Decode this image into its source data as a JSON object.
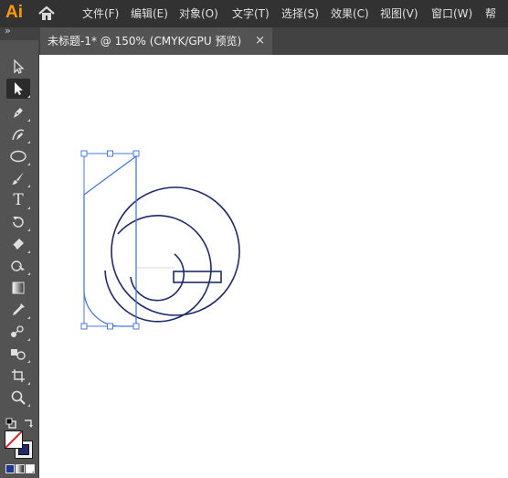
{
  "app": {
    "logo_text": "Ai",
    "home_icon": "home-icon"
  },
  "menu": [
    {
      "label": "文件(F)"
    },
    {
      "label": "编辑(E)"
    },
    {
      "label": "对象(O)"
    },
    {
      "label": "文字(T)"
    },
    {
      "label": "选择(S)"
    },
    {
      "label": "效果(C)"
    },
    {
      "label": "视图(V)"
    },
    {
      "label": "窗口(W)"
    },
    {
      "label": "帮"
    }
  ],
  "document_tab": {
    "label": "未标题-1* @ 150% (CMYK/GPU 预览)",
    "close_label": "×"
  },
  "toolbar": {
    "collapse_label": "»",
    "tools": [
      {
        "icon": "selection-tool-icon"
      },
      {
        "icon": "direct-selection-tool-icon",
        "active": true
      },
      {
        "icon": "pen-tool-icon"
      },
      {
        "icon": "curvature-tool-icon"
      },
      {
        "icon": "ellipse-tool-icon"
      },
      {
        "icon": "paintbrush-tool-icon"
      },
      {
        "icon": "type-tool-icon",
        "text": "T"
      },
      {
        "icon": "rotate-tool-icon"
      },
      {
        "icon": "eraser-tool-icon"
      },
      {
        "icon": "warp-tool-icon"
      },
      {
        "icon": "gradient-tool-icon"
      },
      {
        "icon": "eyedropper-tool-icon"
      },
      {
        "icon": "blend-tool-icon"
      },
      {
        "icon": "shape-builder-tool-icon"
      },
      {
        "icon": "artboard-tool-icon"
      },
      {
        "icon": "zoom-tool-icon"
      }
    ]
  },
  "colors": {
    "stroke_navy": "#1f2a6b",
    "selection_blue": "#4a78d8",
    "menubar_bg": "#323232",
    "toolbar_bg": "#535353",
    "logo_orange": "#ff9a00"
  }
}
